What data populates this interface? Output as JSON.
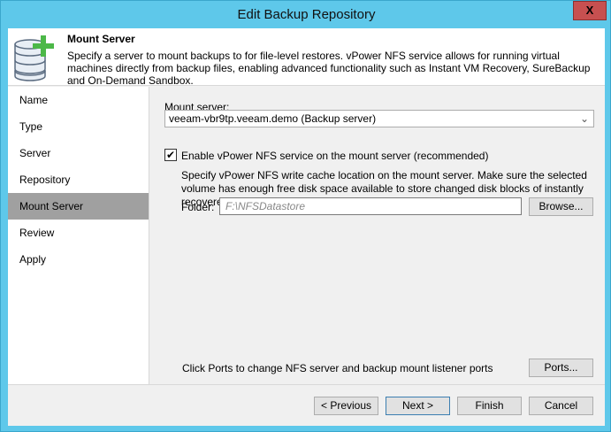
{
  "window": {
    "title": "Edit Backup Repository",
    "close_label": "X"
  },
  "header": {
    "title": "Mount Server",
    "description": "Specify a server to mount backups to for file-level restores. vPower NFS service allows for running virtual machines directly from backup files, enabling advanced functionality such as Instant VM Recovery, SureBackup and On-Demand Sandbox."
  },
  "nav": {
    "items": [
      {
        "label": "Name"
      },
      {
        "label": "Type"
      },
      {
        "label": "Server"
      },
      {
        "label": "Repository"
      },
      {
        "label": "Mount Server"
      },
      {
        "label": "Review"
      },
      {
        "label": "Apply"
      }
    ],
    "selected": "Mount Server"
  },
  "main": {
    "mount_server_label": "Mount server:",
    "mount_server_value": "veeam-vbr9tp.veeam.demo (Backup server)",
    "nfs_checkbox_label": "Enable vPower NFS service on the mount server (recommended)",
    "nfs_checked": true,
    "nfs_description": "Specify vPower NFS write cache location on the mount server. Make sure the selected volume has enough free disk space available to store changed disk blocks of instantly recovered VMs.",
    "folder_label": "Folder:",
    "folder_value": "F:\\NFSDatastore",
    "browse_label": "Browse...",
    "ports_description": "Click Ports to change NFS server and backup mount listener ports",
    "ports_label": "Ports..."
  },
  "footer": {
    "previous": "< Previous",
    "next": "Next >",
    "finish": "Finish",
    "cancel": "Cancel"
  }
}
